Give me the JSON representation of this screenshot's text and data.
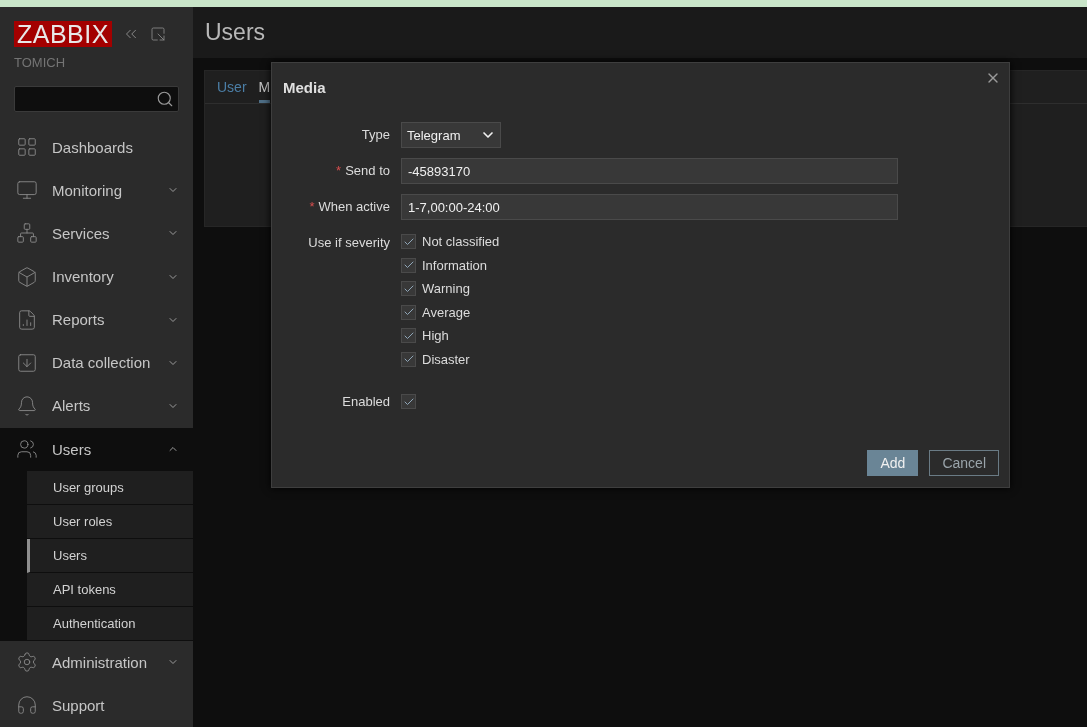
{
  "sidebar": {
    "logo": "ZABBIX",
    "server_name": "TOMICH",
    "items": [
      {
        "label": "Dashboards",
        "expandable": false,
        "expanded": false
      },
      {
        "label": "Monitoring",
        "expandable": true,
        "expanded": false
      },
      {
        "label": "Services",
        "expandable": true,
        "expanded": false
      },
      {
        "label": "Inventory",
        "expandable": true,
        "expanded": false
      },
      {
        "label": "Reports",
        "expandable": true,
        "expanded": false
      },
      {
        "label": "Data collection",
        "expandable": true,
        "expanded": false
      },
      {
        "label": "Alerts",
        "expandable": true,
        "expanded": false
      },
      {
        "label": "Users",
        "expandable": true,
        "expanded": true,
        "children": [
          {
            "label": "User groups",
            "selected": false
          },
          {
            "label": "User roles",
            "selected": false
          },
          {
            "label": "Users",
            "selected": true
          },
          {
            "label": "API tokens",
            "selected": false
          },
          {
            "label": "Authentication",
            "selected": false
          }
        ]
      },
      {
        "label": "Administration",
        "expandable": true,
        "expanded": false
      },
      {
        "label": "Support",
        "expandable": false,
        "expanded": false
      }
    ]
  },
  "page": {
    "title": "Users",
    "tabs": [
      {
        "label": "User",
        "selected": false
      },
      {
        "label": "M",
        "selected": true
      }
    ]
  },
  "dialog": {
    "title": "Media",
    "type": {
      "label": "Type",
      "value": "Telegram"
    },
    "send_to": {
      "label": "Send to",
      "required_mark": "*",
      "value": "-45893170"
    },
    "when_active": {
      "label": "When active",
      "required_mark": "*",
      "value": "1-7,00:00-24:00"
    },
    "severity": {
      "label": "Use if severity",
      "options": [
        {
          "label": "Not classified",
          "checked": true
        },
        {
          "label": "Information",
          "checked": true
        },
        {
          "label": "Warning",
          "checked": true
        },
        {
          "label": "Average",
          "checked": true
        },
        {
          "label": "High",
          "checked": true
        },
        {
          "label": "Disaster",
          "checked": true
        }
      ]
    },
    "enabled": {
      "label": "Enabled",
      "checked": true
    },
    "buttons": [
      {
        "label": "Add",
        "kind": "primary"
      },
      {
        "label": "Cancel",
        "kind": "secondary"
      }
    ]
  }
}
